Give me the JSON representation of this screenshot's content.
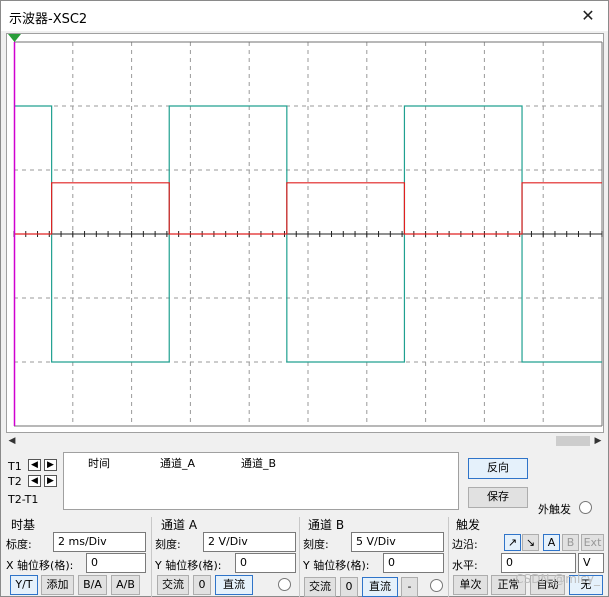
{
  "window": {
    "title": "示波器-XSC2",
    "close_glyph": "✕"
  },
  "screen": {
    "grid": true,
    "background": "#ffffff",
    "channel_colors": {
      "A": "#e02020",
      "B": "#20a090",
      "cursor": "#d000d0"
    }
  },
  "cursor_panel": {
    "rows": [
      "T1",
      "T2",
      "T2-T1"
    ],
    "headers": [
      "时间",
      "通道_A",
      "通道_B"
    ],
    "arrow_left": "◀",
    "arrow_right": "▶"
  },
  "buttons_right": {
    "reverse": "反向",
    "save": "保存",
    "ext_trigger": "外触发"
  },
  "timebase": {
    "title": "时基",
    "scale_label": "标度:",
    "scale_value": "2 ms/Div",
    "xpos_label": "X 轴位移(格):",
    "xpos_value": "0",
    "modes": [
      "Y/T",
      "添加",
      "B/A",
      "A/B"
    ]
  },
  "channel_a": {
    "title": "通道 A",
    "scale_label": "刻度:",
    "scale_value": "2  V/Div",
    "ypos_label": "Y 轴位移(格):",
    "ypos_value": "0",
    "coupling": [
      "交流",
      "0",
      "直流"
    ]
  },
  "channel_b": {
    "title": "通道 B",
    "scale_label": "刻度:",
    "scale_value": "5  V/Div",
    "ypos_label": "Y 轴位移(格):",
    "ypos_value": "0",
    "coupling": [
      "交流",
      "0",
      "直流",
      "-"
    ]
  },
  "trigger": {
    "title": "触发",
    "edge_label": "边沿:",
    "edge_buttons": [
      "↗",
      "↘",
      "A",
      "B",
      "Ext"
    ],
    "level_label": "水平:",
    "level_value": "0",
    "level_unit": "V",
    "modes": [
      "单次",
      "正常",
      "自动",
      "无"
    ]
  },
  "watermark": "CSDN @mlcy_"
}
